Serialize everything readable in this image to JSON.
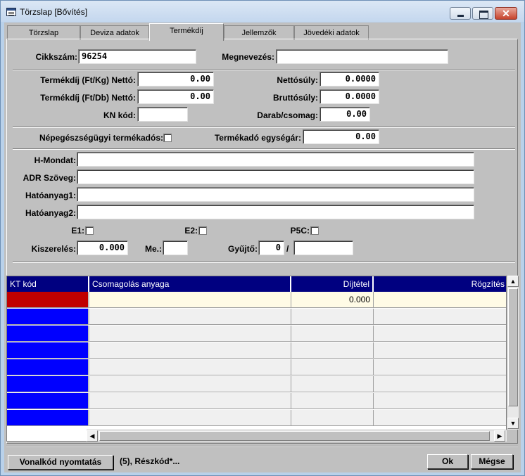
{
  "window": {
    "title": "Törzslap [Bővítés]"
  },
  "tabs": [
    {
      "label": "Törzslap"
    },
    {
      "label": "Deviza adatok"
    },
    {
      "label": "Termékdíj"
    },
    {
      "label": "Jellemzők"
    },
    {
      "label": "Jövedéki adatok"
    }
  ],
  "form": {
    "cikkszam_label": "Cikkszám:",
    "cikkszam_value": "96254",
    "megnevezes_label": "Megnevezés:",
    "megnevezes_value": "",
    "termekdij_kg_label": "Termékdíj (Ft/Kg) Nettó:",
    "termekdij_kg_value": "0.00",
    "nettosuly_label": "Nettósúly:",
    "nettosuly_value": "0.0000",
    "termekdij_db_label": "Termékdíj (Ft/Db) Nettó:",
    "termekdij_db_value": "0.00",
    "bruttosuly_label": "Bruttósúly:",
    "bruttosuly_value": "0.0000",
    "kn_kod_label": "KN kód:",
    "kn_kod_value": "",
    "darab_label": "Darab/csomag:",
    "darab_value": "0.00",
    "nepegeszseg_label": "Népegészségügyi termékadós:",
    "termekado_label": "Termékadó egységár:",
    "termekado_value": "0.00",
    "h_mondat_label": "H-Mondat:",
    "adr_label": "ADR Szöveg:",
    "hatoanyag1_label": "Hatóanyag1:",
    "hatoanyag2_label": "Hatóanyag2:",
    "e1_label": "E1:",
    "e2_label": "E2:",
    "p5c_label": "P5C:",
    "kiszereles_label": "Kiszerelés:",
    "kiszereles_value": "0.000",
    "me_label": "Me.:",
    "me_value": "",
    "gyujto_label": "Gyűjtő:",
    "gyujto_value": "0",
    "gyujto_sep": "/",
    "gyujto_value2": ""
  },
  "grid": {
    "columns": [
      "KT kód",
      "Csomagolás anyaga",
      "Díjtétel",
      "Rögzítés"
    ],
    "rows": [
      [
        "",
        "",
        "0.000",
        ""
      ],
      [
        "",
        "",
        "",
        ""
      ],
      [
        "",
        "",
        "",
        ""
      ],
      [
        "",
        "",
        "",
        ""
      ],
      [
        "",
        "",
        "",
        ""
      ],
      [
        "",
        "",
        "",
        ""
      ],
      [
        "",
        "",
        "",
        ""
      ],
      [
        "",
        "",
        "",
        ""
      ]
    ]
  },
  "footer": {
    "barcode_button": "Vonalkód nyomtatás",
    "status_text": "(5), Részkód*...",
    "ok_button": "Ok",
    "cancel_button": "Mégse"
  },
  "colors": {
    "header_bg": "#000080",
    "row_marker": "#0000ff",
    "current_marker": "#c00000"
  }
}
